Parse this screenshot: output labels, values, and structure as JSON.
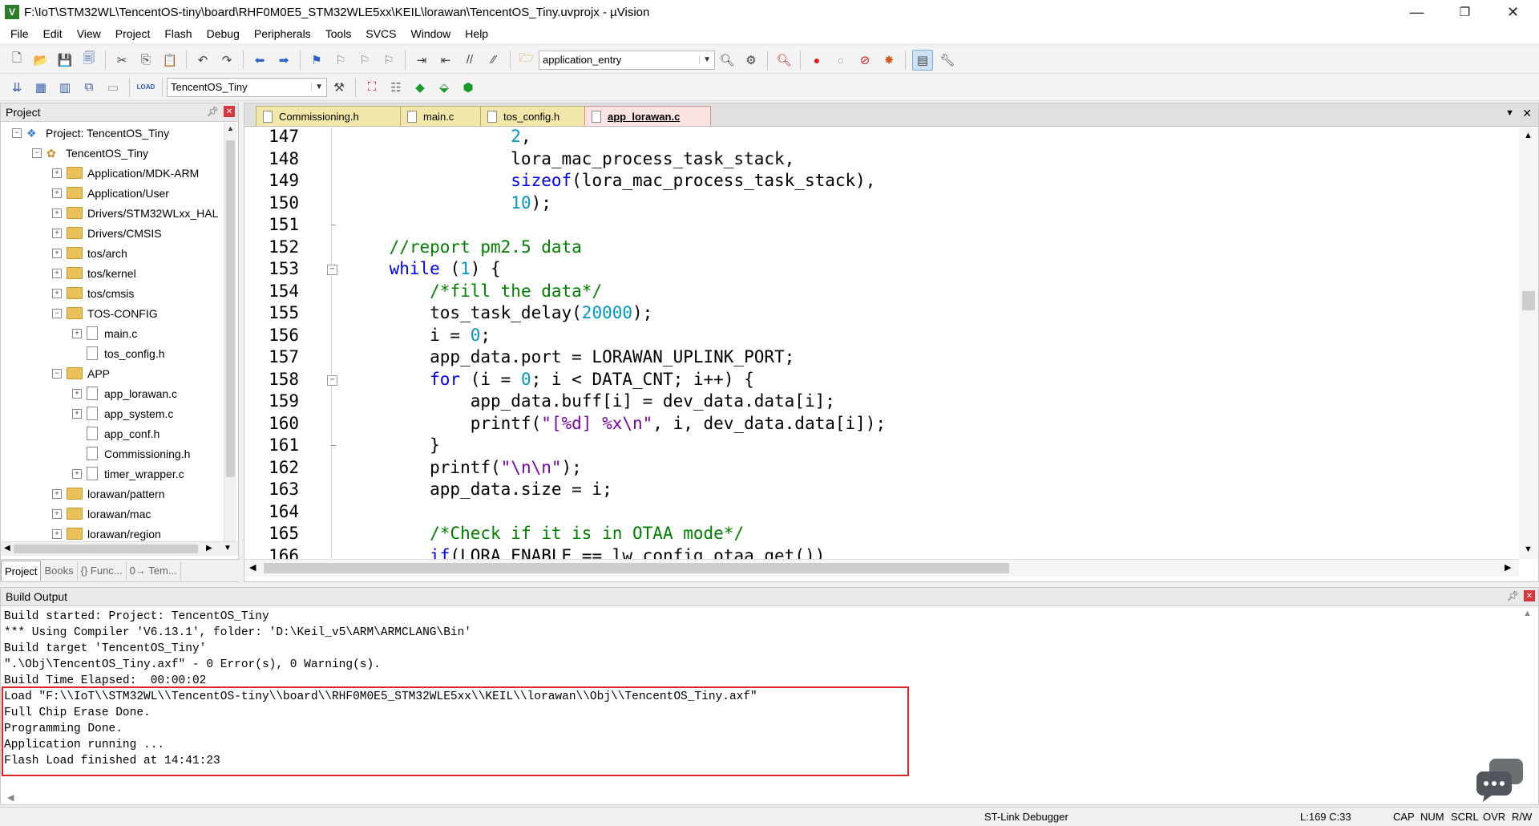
{
  "window": {
    "title": "F:\\IoT\\STM32WL\\TencentOS-tiny\\board\\RHF0M0E5_STM32WLE5xx\\KEIL\\lorawan\\TencentOS_Tiny.uvprojx - µVision",
    "app_icon_letter": "V",
    "minimize": "—",
    "restore": "❐",
    "close": "✕"
  },
  "menu": [
    "File",
    "Edit",
    "View",
    "Project",
    "Flash",
    "Debug",
    "Peripherals",
    "Tools",
    "SVCS",
    "Window",
    "Help"
  ],
  "toolbar1": {
    "function_combo": "application_entry"
  },
  "toolbar2": {
    "target_combo": "TencentOS_Tiny",
    "load_label": "LOAD"
  },
  "project_panel": {
    "title": "Project",
    "tree": [
      {
        "indent": 0,
        "toggle": "⊟",
        "icon": "project",
        "label": "Project: TencentOS_Tiny"
      },
      {
        "indent": 1,
        "toggle": "⊟",
        "icon": "target",
        "label": "TencentOS_Tiny"
      },
      {
        "indent": 2,
        "toggle": "+",
        "icon": "folder",
        "label": "Application/MDK-ARM"
      },
      {
        "indent": 2,
        "toggle": "+",
        "icon": "folder",
        "label": "Application/User"
      },
      {
        "indent": 2,
        "toggle": "+",
        "icon": "folder",
        "label": "Drivers/STM32WLxx_HAL"
      },
      {
        "indent": 2,
        "toggle": "+",
        "icon": "folder",
        "label": "Drivers/CMSIS"
      },
      {
        "indent": 2,
        "toggle": "+",
        "icon": "folder",
        "label": "tos/arch"
      },
      {
        "indent": 2,
        "toggle": "+",
        "icon": "folder",
        "label": "tos/kernel"
      },
      {
        "indent": 2,
        "toggle": "+",
        "icon": "folder",
        "label": "tos/cmsis"
      },
      {
        "indent": 2,
        "toggle": "−",
        "icon": "folder",
        "label": "TOS-CONFIG"
      },
      {
        "indent": 3,
        "toggle": "+",
        "icon": "file",
        "label": "main.c"
      },
      {
        "indent": 3,
        "toggle": "",
        "icon": "file",
        "label": "tos_config.h"
      },
      {
        "indent": 2,
        "toggle": "−",
        "icon": "folder",
        "label": "APP"
      },
      {
        "indent": 3,
        "toggle": "+",
        "icon": "file",
        "label": "app_lorawan.c"
      },
      {
        "indent": 3,
        "toggle": "+",
        "icon": "file",
        "label": "app_system.c"
      },
      {
        "indent": 3,
        "toggle": "",
        "icon": "file",
        "label": "app_conf.h"
      },
      {
        "indent": 3,
        "toggle": "",
        "icon": "file",
        "label": "Commissioning.h"
      },
      {
        "indent": 3,
        "toggle": "+",
        "icon": "file",
        "label": "timer_wrapper.c"
      },
      {
        "indent": 2,
        "toggle": "+",
        "icon": "folder",
        "label": "lorawan/pattern"
      },
      {
        "indent": 2,
        "toggle": "+",
        "icon": "folder",
        "label": "lorawan/mac"
      },
      {
        "indent": 2,
        "toggle": "+",
        "icon": "folder",
        "label": "lorawan/region"
      }
    ],
    "tabs": [
      "Project",
      "Books",
      "{} Func...",
      "0→ Tem..."
    ]
  },
  "editor": {
    "tabs": [
      {
        "label": "Commissioning.h",
        "active": false
      },
      {
        "label": "main.c",
        "active": false
      },
      {
        "label": "tos_config.h",
        "active": false
      },
      {
        "label": "app_lorawan.c",
        "active": true
      }
    ],
    "lines": [
      {
        "n": "147",
        "fold": "",
        "html": "                <span class='nm'>2</span>,"
      },
      {
        "n": "148",
        "fold": "",
        "html": "                lora_mac_process_task_stack,"
      },
      {
        "n": "149",
        "fold": "",
        "html": "                <span class='kw'>sizeof</span>(lora_mac_process_task_stack),"
      },
      {
        "n": "150",
        "fold": "",
        "html": "                <span class='nm'>10</span>);"
      },
      {
        "n": "151",
        "fold": "-",
        "html": ""
      },
      {
        "n": "152",
        "fold": "",
        "html": "    <span class='cm'>//report pm2.5 data</span>"
      },
      {
        "n": "153",
        "fold": "⊟",
        "html": "    <span class='kw'>while</span> (<span class='nm'>1</span>) {"
      },
      {
        "n": "154",
        "fold": "",
        "html": "        <span class='cm'>/*fill the data*/</span>"
      },
      {
        "n": "155",
        "fold": "",
        "html": "        tos_task_delay(<span class='nm'>20000</span>);"
      },
      {
        "n": "156",
        "fold": "",
        "html": "        i = <span class='nm'>0</span>;"
      },
      {
        "n": "157",
        "fold": "",
        "html": "        app_data.port = LORAWAN_UPLINK_PORT;"
      },
      {
        "n": "158",
        "fold": "⊟",
        "html": "        <span class='kw'>for</span> (i = <span class='nm'>0</span>; i &lt; DATA_CNT; i++) {"
      },
      {
        "n": "159",
        "fold": "",
        "html": "            app_data.buff[i] = dev_data.data[i];"
      },
      {
        "n": "160",
        "fold": "",
        "html": "            printf(<span class='st'>\"[%d] %x\\n\"</span>, i, dev_data.data[i]);"
      },
      {
        "n": "161",
        "fold": "-",
        "html": "        }"
      },
      {
        "n": "162",
        "fold": "",
        "html": "        printf(<span class='st'>\"\\n\\n\"</span>);"
      },
      {
        "n": "163",
        "fold": "",
        "html": "        app_data.size = i;"
      },
      {
        "n": "164",
        "fold": "",
        "html": ""
      },
      {
        "n": "165",
        "fold": "",
        "html": "        <span class='cm'>/*Check if it is in OTAA mode*/</span>"
      },
      {
        "n": "166",
        "fold": "",
        "html": "        <span class='kw'>if</span>(LORA_ENABLE == lw_config_otaa_get())"
      }
    ]
  },
  "build_output": {
    "title": "Build Output",
    "lines": [
      "Build started: Project: TencentOS_Tiny",
      "*** Using Compiler 'V6.13.1', folder: 'D:\\Keil_v5\\ARM\\ARMCLANG\\Bin'",
      "Build target 'TencentOS_Tiny'",
      "\".\\Obj\\TencentOS_Tiny.axf\" - 0 Error(s), 0 Warning(s).",
      "Build Time Elapsed:  00:00:02",
      "Load \"F:\\\\IoT\\\\STM32WL\\\\TencentOS-tiny\\\\board\\\\RHF0M0E5_STM32WLE5xx\\\\KEIL\\\\lorawan\\\\Obj\\\\TencentOS_Tiny.axf\"",
      "Full Chip Erase Done.",
      "Programming Done.",
      "Application running ...",
      "Flash Load finished at 14:41:23"
    ]
  },
  "statusbar": {
    "debugger": "ST-Link Debugger",
    "cursor": "L:169 C:33",
    "cap": "CAP",
    "num": "NUM",
    "scrl": "SCRL",
    "ovr": "OVR",
    "rw": "R/W"
  }
}
